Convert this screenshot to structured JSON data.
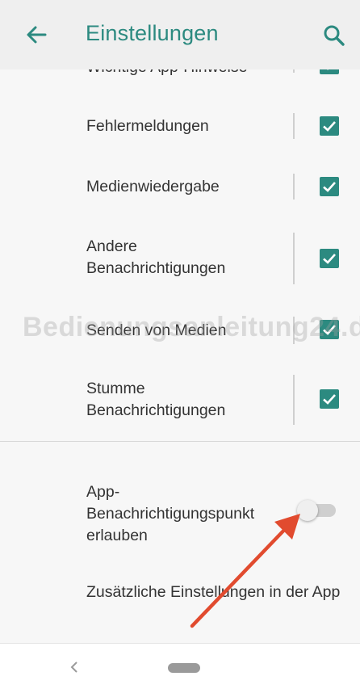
{
  "app_bar": {
    "title": "Einstellungen",
    "accent_color": "#2c8a80",
    "back_icon": "arrow-left-icon",
    "search_icon": "search-icon"
  },
  "settings": [
    {
      "label": "Wichtige App-Hinweise",
      "checked": true
    },
    {
      "label": "Fehlermeldungen",
      "checked": true
    },
    {
      "label": "Medienwiedergabe",
      "checked": true
    },
    {
      "label": "Andere Benachrichtigungen",
      "checked": true
    },
    {
      "label": "Senden von Medien",
      "checked": true
    },
    {
      "label": "Stumme Benachrichtigungen",
      "checked": true
    }
  ],
  "toggle_setting": {
    "label": "App-Benachrichtigungspunkt erlauben",
    "on": false
  },
  "extra": {
    "label": "Zusätzliche Einstellungen in der App"
  },
  "watermark": "Bedienungsanleitung24.de",
  "nav": {
    "back_icon": "chevron-left-icon",
    "home_icon": "home-pill-icon"
  }
}
